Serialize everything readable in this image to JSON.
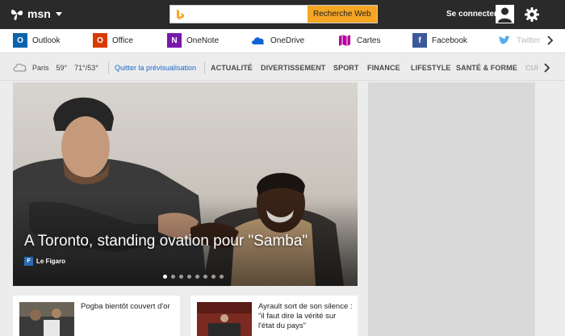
{
  "topbar": {
    "logo_text": "msn",
    "search": {
      "placeholder": "",
      "button_label": "Recherche Web"
    },
    "signin_label": "Se connecter"
  },
  "apps": [
    {
      "label": "Outlook",
      "icon": "outlook-icon",
      "color": "#0a64ad"
    },
    {
      "label": "Office",
      "icon": "office-icon",
      "color": "#d83b01"
    },
    {
      "label": "OneNote",
      "icon": "onenote-icon",
      "color": "#7719aa"
    },
    {
      "label": "OneDrive",
      "icon": "onedrive-icon",
      "color": "#0f63d4"
    },
    {
      "label": "Cartes",
      "icon": "maps-icon",
      "color": "#b4009e"
    },
    {
      "label": "Facebook",
      "icon": "facebook-icon",
      "color": "#3b5998"
    },
    {
      "label": "Twitter",
      "icon": "twitter-icon",
      "color": "#55acee"
    }
  ],
  "nav": {
    "weather": {
      "city": "Paris",
      "temp": "59°",
      "range": "71°/53°"
    },
    "quit_preview": "Quitter la prévisualisation",
    "categories": [
      "ACTUALITÉ",
      "DIVERTISSEMENT",
      "SPORT",
      "FINANCE",
      "LIFESTYLE",
      "SANTÉ & FORME",
      "CUI"
    ]
  },
  "hero": {
    "headline": "A Toronto, standing ovation pour \"Samba\"",
    "source": "Le Figaro",
    "slides": 8,
    "active_slide": 1
  },
  "cards": [
    {
      "title": "Pogba bientôt couvert d'or"
    },
    {
      "title": "Ayrault sort de son silence : \"il faut dire la vérité sur l'état du pays\""
    }
  ]
}
